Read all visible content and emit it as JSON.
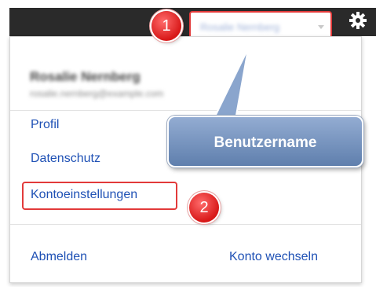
{
  "topbar": {
    "username_placeholder": "Rosalie Nernberg",
    "settings_icon": "gear-icon"
  },
  "account": {
    "name": "Rosalie Nernberg",
    "email": "rosalie.nernberg@example.com"
  },
  "menu": {
    "profile": "Profil",
    "privacy": "Datenschutz",
    "account_settings": "Kontoeinstellungen",
    "logout": "Abmelden",
    "switch_account": "Konto wechseln"
  },
  "annotations": {
    "marker_1": "1",
    "marker_2": "2",
    "callout": "Benutzername"
  },
  "colors": {
    "accent_red": "#e23a3a",
    "link_blue": "#1f51b5",
    "callout_blue": "#6f8fbf",
    "topbar": "#2a2a2a"
  }
}
